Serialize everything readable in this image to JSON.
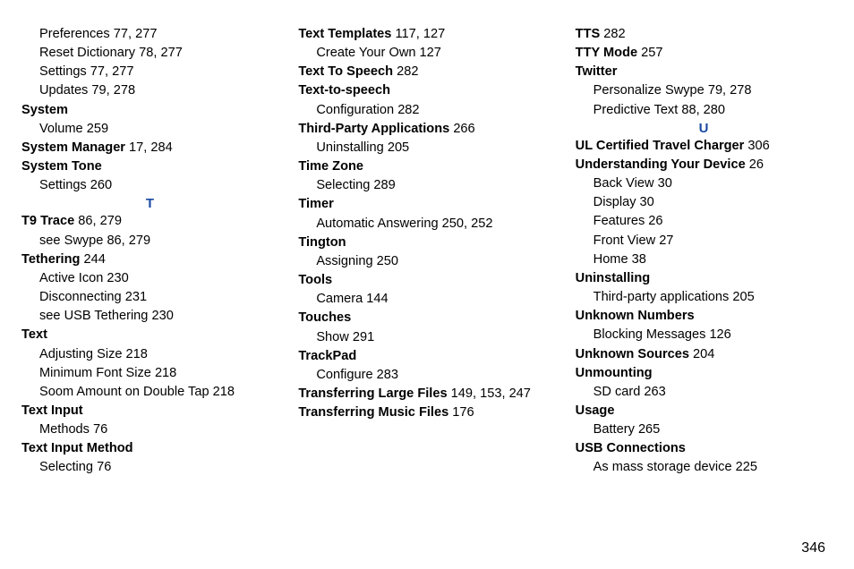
{
  "page_number": "346",
  "columns": [
    {
      "items": [
        {
          "type": "line",
          "indent": 1,
          "bold": false,
          "text": "Preferences 77, 277"
        },
        {
          "type": "line",
          "indent": 1,
          "bold": false,
          "text": "Reset Dictionary 78, 277"
        },
        {
          "type": "line",
          "indent": 1,
          "bold": false,
          "text": "Settings 77, 277"
        },
        {
          "type": "line",
          "indent": 1,
          "bold": false,
          "text": "Updates 79, 278"
        },
        {
          "type": "line",
          "indent": 0,
          "bold": true,
          "text": "System"
        },
        {
          "type": "line",
          "indent": 1,
          "bold": false,
          "text": "Volume 259"
        },
        {
          "type": "mixed",
          "indent": 0,
          "bold": "System Manager",
          "rest": " 17, 284"
        },
        {
          "type": "line",
          "indent": 0,
          "bold": true,
          "text": "System Tone"
        },
        {
          "type": "line",
          "indent": 1,
          "bold": false,
          "text": "Settings 260"
        },
        {
          "type": "letter",
          "text": "T"
        },
        {
          "type": "mixed",
          "indent": 0,
          "bold": "T9 Trace",
          "rest": " 86, 279"
        },
        {
          "type": "line",
          "indent": 1,
          "bold": false,
          "text": "see Swype 86, 279"
        },
        {
          "type": "mixed",
          "indent": 0,
          "bold": "Tethering",
          "rest": " 244"
        },
        {
          "type": "line",
          "indent": 1,
          "bold": false,
          "text": "Active Icon 230"
        },
        {
          "type": "line",
          "indent": 1,
          "bold": false,
          "text": "Disconnecting 231"
        },
        {
          "type": "line",
          "indent": 1,
          "bold": false,
          "text": "see USB Tethering 230"
        },
        {
          "type": "line",
          "indent": 0,
          "bold": true,
          "text": "Text"
        },
        {
          "type": "line",
          "indent": 1,
          "bold": false,
          "text": "Adjusting Size 218"
        },
        {
          "type": "line",
          "indent": 1,
          "bold": false,
          "text": "Minimum Font Size 218"
        },
        {
          "type": "line",
          "indent": 1,
          "bold": false,
          "text": "Soom Amount on Double Tap 218"
        },
        {
          "type": "line",
          "indent": 0,
          "bold": true,
          "text": "Text Input"
        },
        {
          "type": "line",
          "indent": 1,
          "bold": false,
          "text": "Methods 76"
        },
        {
          "type": "line",
          "indent": 0,
          "bold": true,
          "text": "Text Input Method"
        },
        {
          "type": "line",
          "indent": 1,
          "bold": false,
          "text": "Selecting 76"
        }
      ]
    },
    {
      "items": [
        {
          "type": "mixed",
          "indent": 0,
          "bold": "Text Templates",
          "rest": " 117, 127"
        },
        {
          "type": "line",
          "indent": 1,
          "bold": false,
          "text": "Create Your Own 127"
        },
        {
          "type": "mixed",
          "indent": 0,
          "bold": "Text To Speech",
          "rest": " 282"
        },
        {
          "type": "line",
          "indent": 0,
          "bold": true,
          "text": "Text-to-speech"
        },
        {
          "type": "line",
          "indent": 1,
          "bold": false,
          "text": "Configuration 282"
        },
        {
          "type": "mixed",
          "indent": 0,
          "bold": "Third-Party Applications",
          "rest": " 266"
        },
        {
          "type": "line",
          "indent": 1,
          "bold": false,
          "text": "Uninstalling 205"
        },
        {
          "type": "line",
          "indent": 0,
          "bold": true,
          "text": "Time Zone"
        },
        {
          "type": "line",
          "indent": 1,
          "bold": false,
          "text": "Selecting 289"
        },
        {
          "type": "line",
          "indent": 0,
          "bold": true,
          "text": "Timer"
        },
        {
          "type": "line",
          "indent": 1,
          "bold": false,
          "text": "Automatic Answering 250, 252"
        },
        {
          "type": "line",
          "indent": 0,
          "bold": true,
          "text": "Tington"
        },
        {
          "type": "line",
          "indent": 1,
          "bold": false,
          "text": "Assigning 250"
        },
        {
          "type": "line",
          "indent": 0,
          "bold": true,
          "text": "Tools"
        },
        {
          "type": "line",
          "indent": 1,
          "bold": false,
          "text": "Camera 144"
        },
        {
          "type": "line",
          "indent": 0,
          "bold": true,
          "text": "Touches"
        },
        {
          "type": "line",
          "indent": 1,
          "bold": false,
          "text": "Show 291"
        },
        {
          "type": "line",
          "indent": 0,
          "bold": true,
          "text": "TrackPad"
        },
        {
          "type": "line",
          "indent": 1,
          "bold": false,
          "text": "Configure 283"
        },
        {
          "type": "mixed",
          "indent": 0,
          "bold": "Transferring Large Files",
          "rest": " 149, 153, 247"
        },
        {
          "type": "mixed",
          "indent": 0,
          "bold": "Transferring Music Files",
          "rest": " 176"
        }
      ]
    },
    {
      "items": [
        {
          "type": "mixed",
          "indent": 0,
          "bold": "TTS",
          "rest": " 282"
        },
        {
          "type": "mixed",
          "indent": 0,
          "bold": "TTY Mode",
          "rest": " 257"
        },
        {
          "type": "line",
          "indent": 0,
          "bold": true,
          "text": "Twitter"
        },
        {
          "type": "line",
          "indent": 1,
          "bold": false,
          "text": "Personalize Swype 79, 278"
        },
        {
          "type": "line",
          "indent": 1,
          "bold": false,
          "text": "Predictive Text 88, 280"
        },
        {
          "type": "letter",
          "text": "U"
        },
        {
          "type": "mixed",
          "indent": 0,
          "bold": "UL Certified Travel Charger",
          "rest": " 306"
        },
        {
          "type": "mixed",
          "indent": 0,
          "bold": "Understanding Your Device",
          "rest": " 26"
        },
        {
          "type": "line",
          "indent": 1,
          "bold": false,
          "text": "Back View 30"
        },
        {
          "type": "line",
          "indent": 1,
          "bold": false,
          "text": "Display 30"
        },
        {
          "type": "line",
          "indent": 1,
          "bold": false,
          "text": "Features 26"
        },
        {
          "type": "line",
          "indent": 1,
          "bold": false,
          "text": "Front View 27"
        },
        {
          "type": "line",
          "indent": 1,
          "bold": false,
          "text": "Home 38"
        },
        {
          "type": "line",
          "indent": 0,
          "bold": true,
          "text": "Uninstalling"
        },
        {
          "type": "line",
          "indent": 1,
          "bold": false,
          "text": "Third-party applications 205"
        },
        {
          "type": "line",
          "indent": 0,
          "bold": true,
          "text": "Unknown Numbers"
        },
        {
          "type": "line",
          "indent": 1,
          "bold": false,
          "text": "Blocking Messages 126"
        },
        {
          "type": "mixed",
          "indent": 0,
          "bold": "Unknown Sources",
          "rest": " 204"
        },
        {
          "type": "line",
          "indent": 0,
          "bold": true,
          "text": "Unmounting"
        },
        {
          "type": "line",
          "indent": 1,
          "bold": false,
          "text": "SD card 263"
        },
        {
          "type": "line",
          "indent": 0,
          "bold": true,
          "text": "Usage"
        },
        {
          "type": "line",
          "indent": 1,
          "bold": false,
          "text": "Battery 265"
        },
        {
          "type": "line",
          "indent": 0,
          "bold": true,
          "text": "USB Connections"
        },
        {
          "type": "line",
          "indent": 1,
          "bold": false,
          "text": "As mass storage device 225"
        }
      ]
    }
  ]
}
